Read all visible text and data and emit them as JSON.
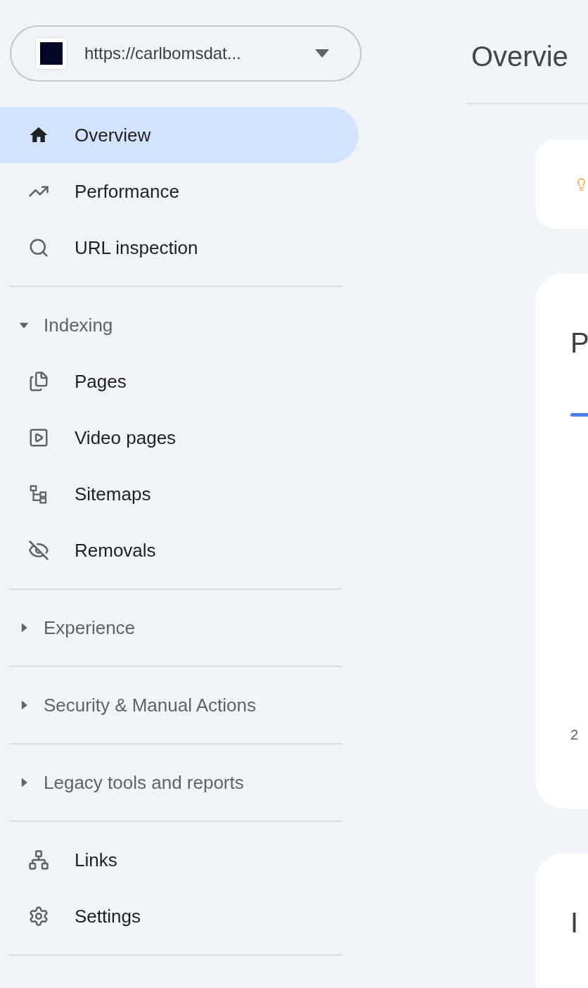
{
  "property_selector": {
    "url": "https://carlbomsdat..."
  },
  "nav_groups": [
    {
      "items": [
        {
          "label": "Overview",
          "selected": true
        },
        {
          "label": "Performance",
          "selected": false
        },
        {
          "label": "URL inspection",
          "selected": false
        }
      ]
    },
    {
      "title": "Indexing",
      "expanded": true,
      "items": [
        {
          "label": "Pages",
          "selected": false
        },
        {
          "label": "Video pages",
          "selected": false
        },
        {
          "label": "Sitemaps",
          "selected": false
        },
        {
          "label": "Removals",
          "selected": false
        }
      ]
    },
    {
      "title": "Experience",
      "expanded": false
    },
    {
      "title": "Security & Manual Actions",
      "expanded": false
    },
    {
      "title": "Legacy tools and reports",
      "expanded": false
    },
    {
      "items": [
        {
          "label": "Links",
          "selected": false
        },
        {
          "label": "Settings",
          "selected": false
        }
      ]
    }
  ],
  "main": {
    "title": "Overvie",
    "cards": [
      {
        "kind": "tip"
      },
      {
        "kind": "chart",
        "title": "P",
        "axis_label": "2"
      },
      {
        "kind": "section",
        "title": "I"
      }
    ]
  }
}
